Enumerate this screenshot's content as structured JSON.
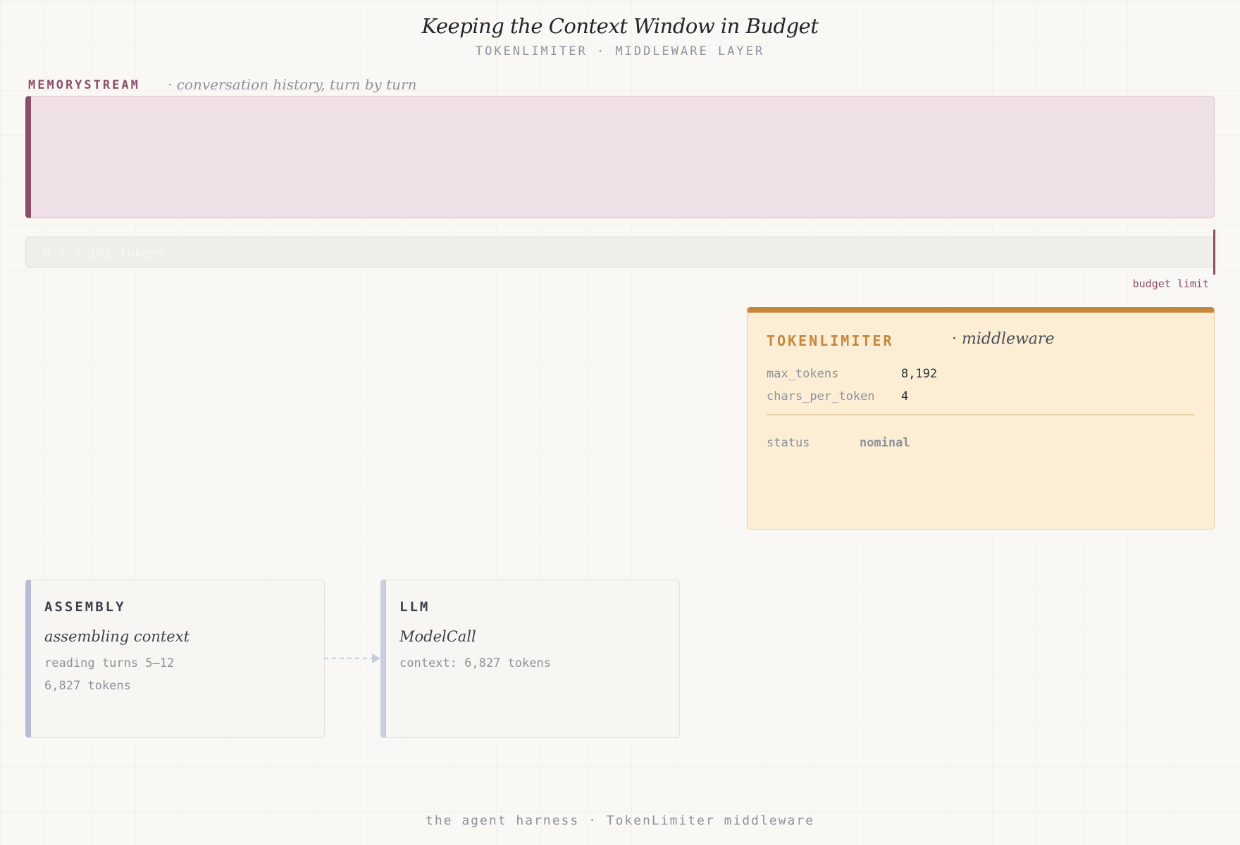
{
  "header": {
    "title": "Keeping the Context Window in Budget",
    "subtitle": "TOKENLIMITER · MIDDLEWARE LAYER"
  },
  "memorystream": {
    "label": "MEMORYSTREAM",
    "description": "· conversation history, turn by turn"
  },
  "budget": {
    "used_tokens": 0,
    "max_tokens": 8192,
    "text": "0 / 8,192 tokens",
    "limit_label": "budget limit"
  },
  "tokenlimiter": {
    "name": "TOKENLIMITER",
    "kind": "· middleware",
    "params": [
      {
        "key": "max_tokens",
        "value": "8,192"
      },
      {
        "key": "chars_per_token",
        "value": "4"
      }
    ],
    "status_key": "status",
    "status_value": "nominal"
  },
  "assembly": {
    "name": "ASSEMBLY",
    "description": "assembling context",
    "lines": [
      "reading turns 5–12",
      "6,827 tokens"
    ]
  },
  "llm": {
    "name": "LLM",
    "description": "ModelCall",
    "lines": [
      "context: 6,827 tokens"
    ]
  },
  "footer": {
    "text": "the agent harness · TokenLimiter middleware"
  },
  "colors": {
    "memorystream_accent": "#8a4d6a",
    "memorystream_fill": "#efdfe6",
    "tokenlimiter_accent": "#c6873d",
    "tokenlimiter_fill": "#fbeed5",
    "stage_accent": "#b7bad5",
    "background": "#f9f8f4"
  }
}
